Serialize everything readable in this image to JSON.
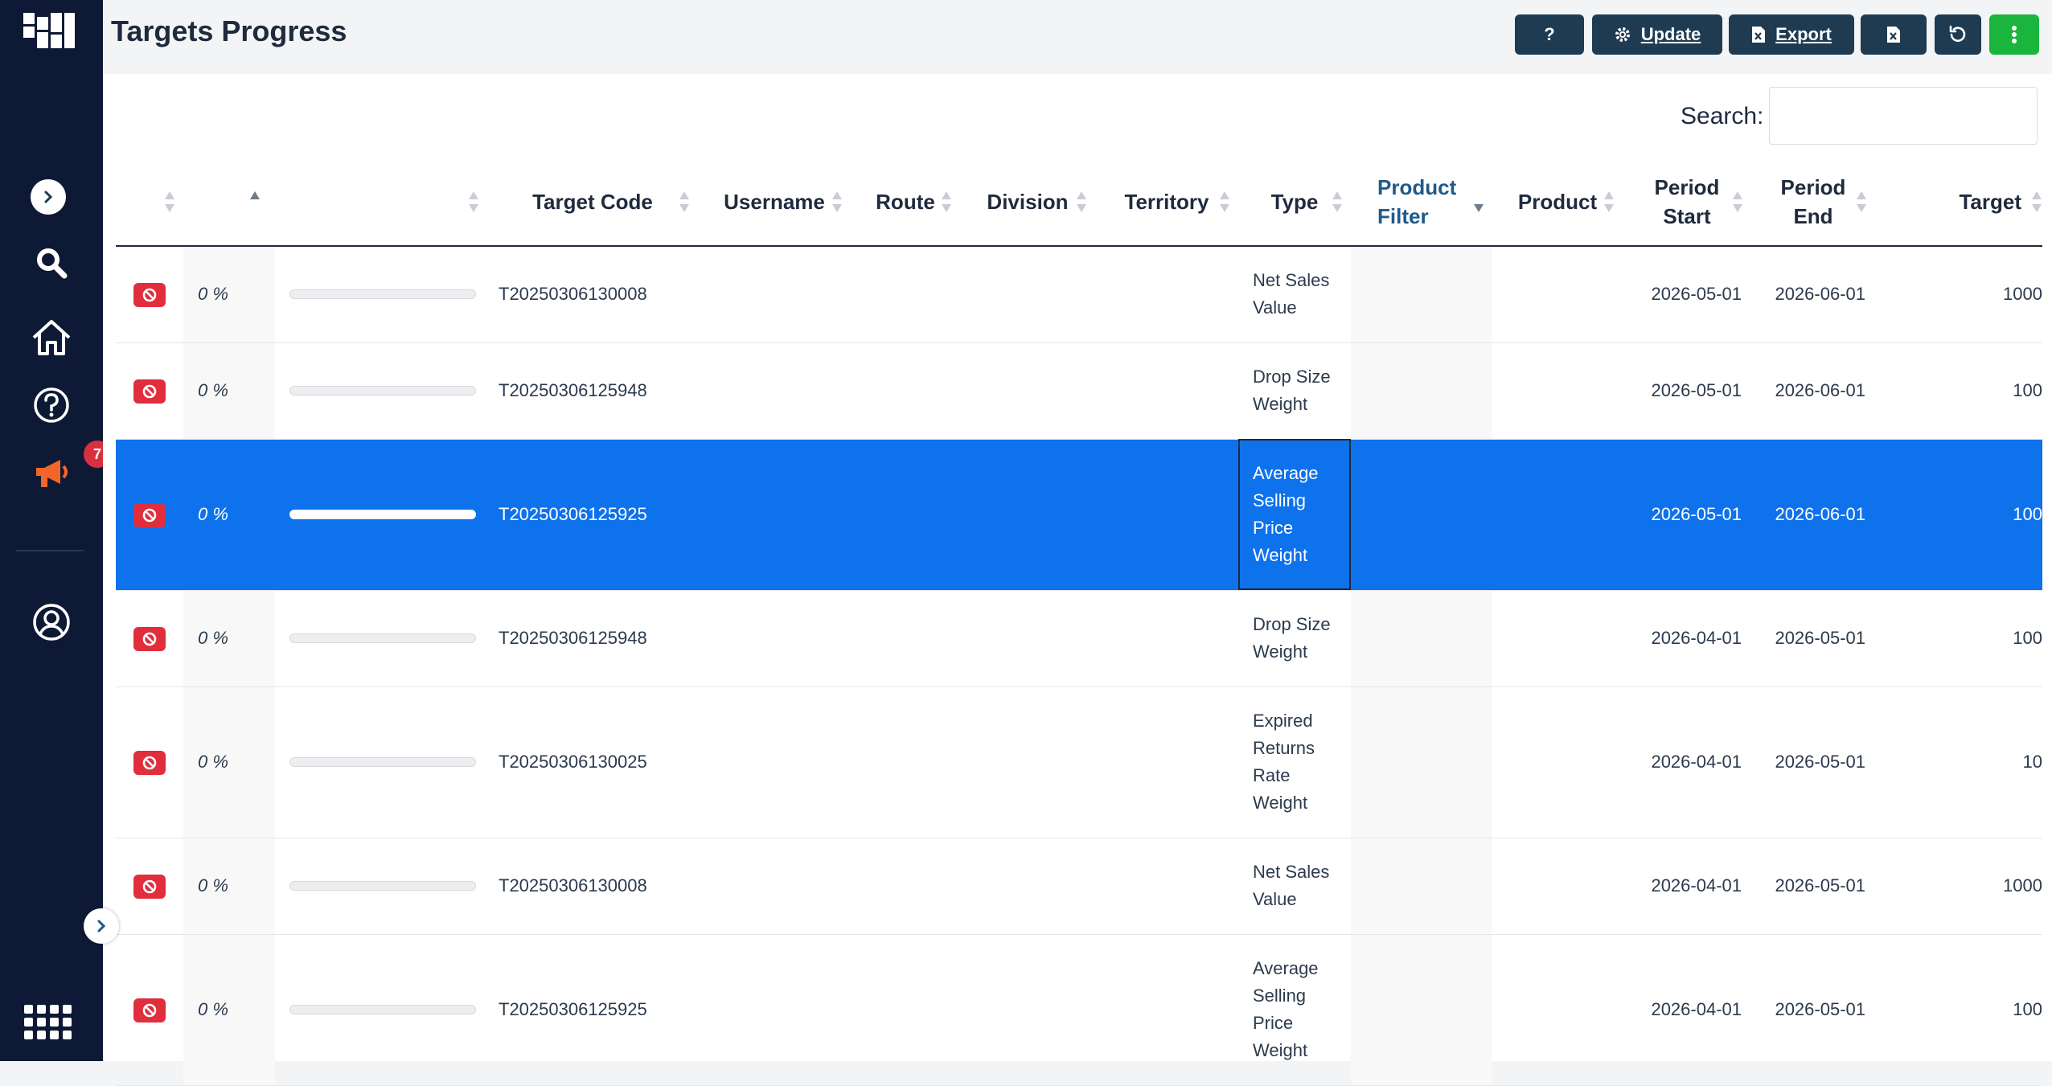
{
  "app": {
    "title": "Targets Progress"
  },
  "sidebar": {
    "items": [
      {
        "name": "expand",
        "icon": "chevron-right-icon"
      },
      {
        "name": "search",
        "icon": "search-icon"
      },
      {
        "name": "home",
        "icon": "home-icon"
      },
      {
        "name": "help",
        "icon": "question-circle-icon"
      },
      {
        "name": "announcements",
        "icon": "megaphone-icon",
        "badge": "7"
      },
      {
        "name": "profile",
        "icon": "user-circle-icon"
      }
    ],
    "accent": "#f2662a",
    "background": "#0e1a35"
  },
  "toolbar": {
    "help_label": "?",
    "update_label": "Update",
    "export_label": "Export",
    "colors": {
      "button": "#1e3b52",
      "more": "#19b53c"
    }
  },
  "search": {
    "label": "Search:",
    "value": ""
  },
  "table": {
    "columns": [
      "",
      "",
      "",
      "Target Code",
      "Username",
      "Route",
      "Division",
      "Territory",
      "Type",
      "Product Filter",
      "Product",
      "Period Start",
      "Period End",
      "Target"
    ],
    "rows": [
      {
        "pct": "0 %",
        "progress": 0,
        "code": "T20250306130008",
        "type": "Net Sales Value",
        "start": "2026-05-01",
        "end": "2026-06-01",
        "target": "1000"
      },
      {
        "pct": "0 %",
        "progress": 0,
        "code": "T20250306125948",
        "type": "Drop Size Weight",
        "start": "2026-05-01",
        "end": "2026-06-01",
        "target": "100"
      },
      {
        "pct": "0 %",
        "progress": 0,
        "code": "T20250306125925",
        "type": "Average Selling Price Weight",
        "start": "2026-05-01",
        "end": "2026-06-01",
        "target": "100",
        "selected": true
      },
      {
        "pct": "0 %",
        "progress": 0,
        "code": "T20250306125948",
        "type": "Drop Size Weight",
        "start": "2026-04-01",
        "end": "2026-05-01",
        "target": "100"
      },
      {
        "pct": "0 %",
        "progress": 0,
        "code": "T20250306130025",
        "type": "Expired Returns Rate Weight",
        "start": "2026-04-01",
        "end": "2026-05-01",
        "target": "10"
      },
      {
        "pct": "0 %",
        "progress": 0,
        "code": "T20250306130008",
        "type": "Net Sales Value",
        "start": "2026-04-01",
        "end": "2026-05-01",
        "target": "1000"
      },
      {
        "pct": "0 %",
        "progress": 0,
        "code": "T20250306125925",
        "type": "Average Selling Price Weight",
        "start": "2026-04-01",
        "end": "2026-05-01",
        "target": "100"
      }
    ],
    "selected_color": "#0e72ed",
    "action_color": "#e02e3d"
  }
}
